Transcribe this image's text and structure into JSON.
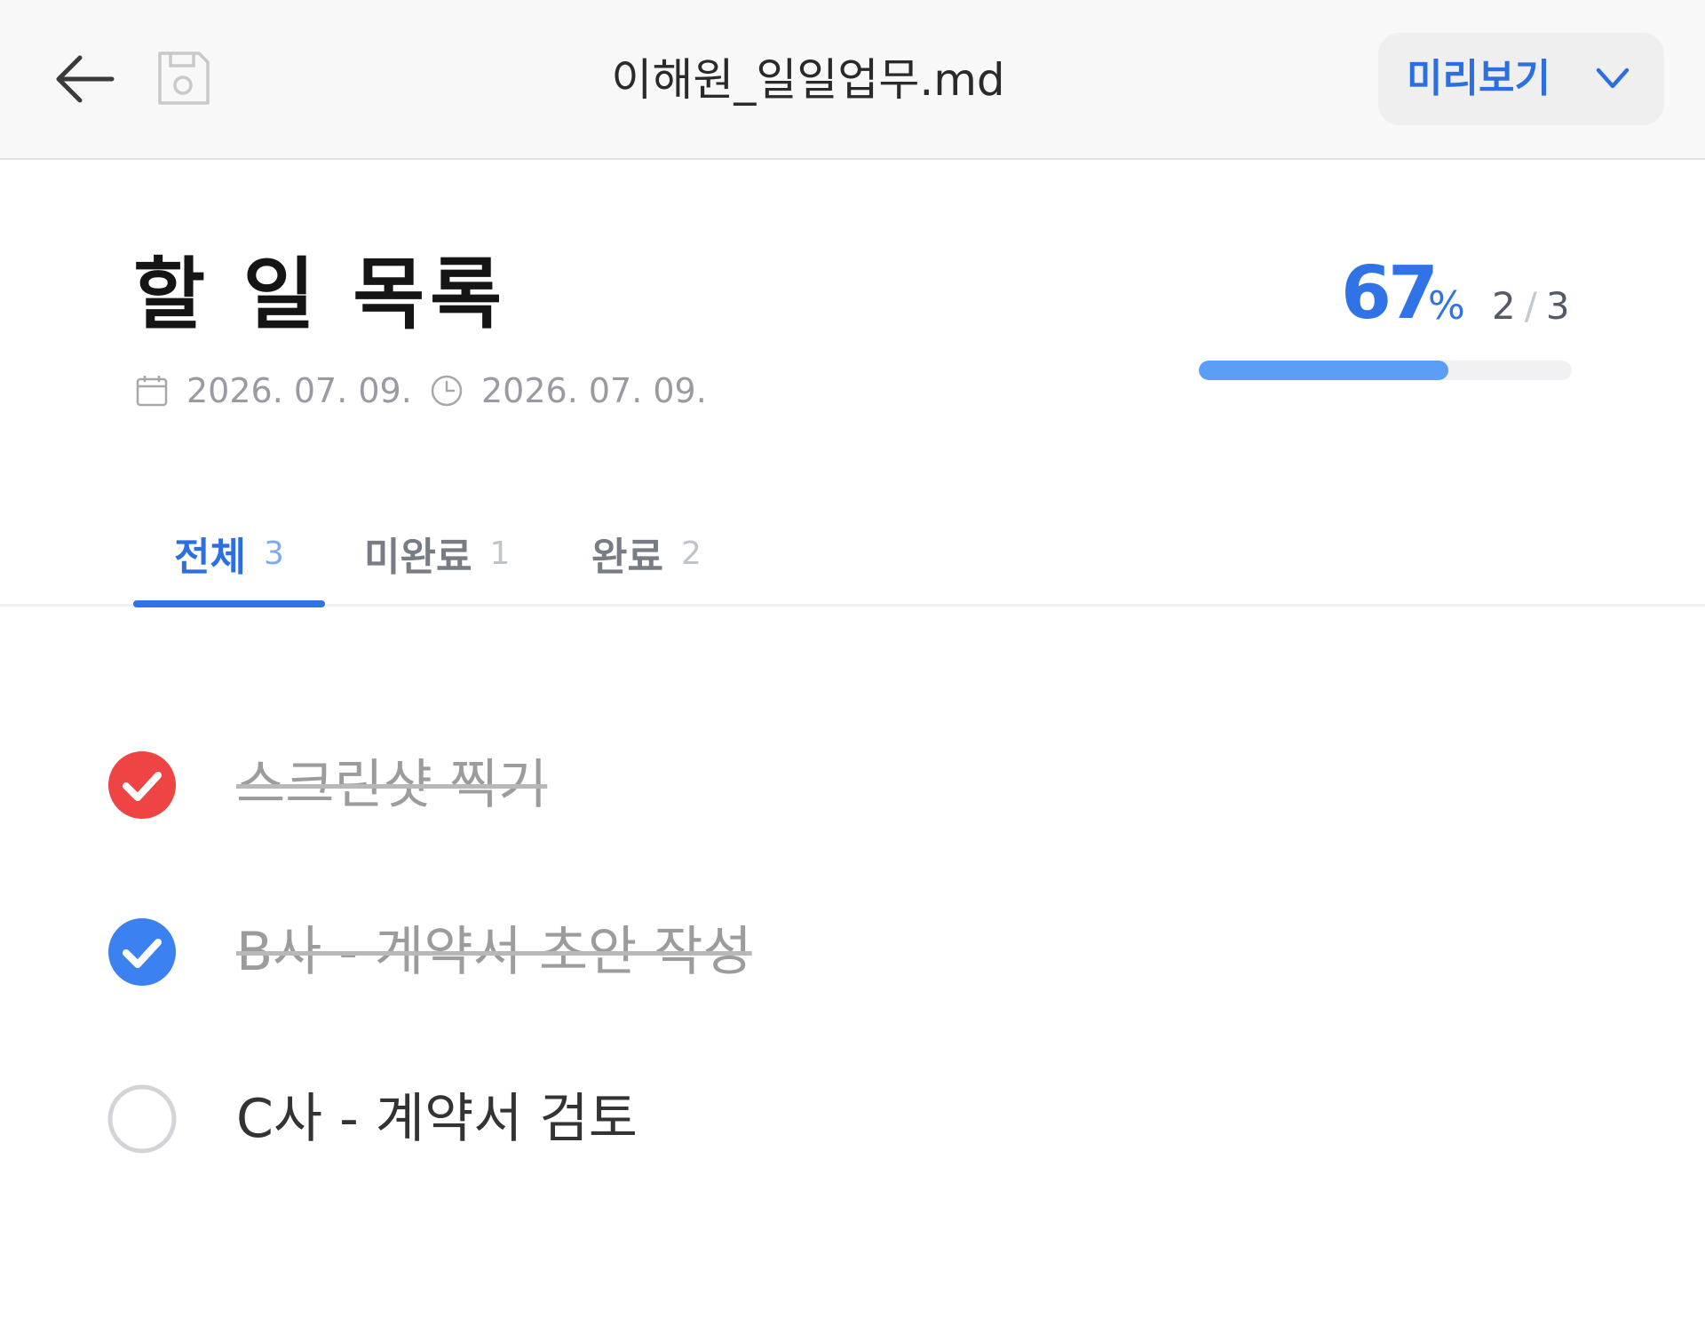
{
  "header": {
    "file_title": "이해원_일일업무.md",
    "view_mode_label": "미리보기",
    "back_icon": "arrow-left-icon",
    "save_icon": "floppy-disk-icon",
    "dropdown_icon": "chevron-down-icon"
  },
  "document": {
    "title": "할 일 목록",
    "created_date": "2026. 07. 09.",
    "modified_date": "2026. 07. 09.",
    "created_icon": "calendar-icon",
    "modified_icon": "clock-icon"
  },
  "progress": {
    "percent": "67",
    "percent_sign": "%",
    "completed": "2",
    "total": "3",
    "fraction": 0.67
  },
  "tabs": [
    {
      "label": "전체",
      "count": "3",
      "active": true
    },
    {
      "label": "미완료",
      "count": "1",
      "active": false
    },
    {
      "label": "완료",
      "count": "2",
      "active": false
    }
  ],
  "todos": [
    {
      "text": "스크린샷 찍기",
      "done": true,
      "check_color": "#ee4444"
    },
    {
      "text": "B사 - 계약서 초안 작성",
      "done": true,
      "check_color": "#3b82f0"
    },
    {
      "text": "C사 - 계약서 검토",
      "done": false,
      "check_color": "#d4d4d8"
    }
  ],
  "colors": {
    "accent": "#2f73e6",
    "progress_fill": "#5c9ef5",
    "done_red": "#ee4444",
    "done_blue": "#3b82f0"
  }
}
